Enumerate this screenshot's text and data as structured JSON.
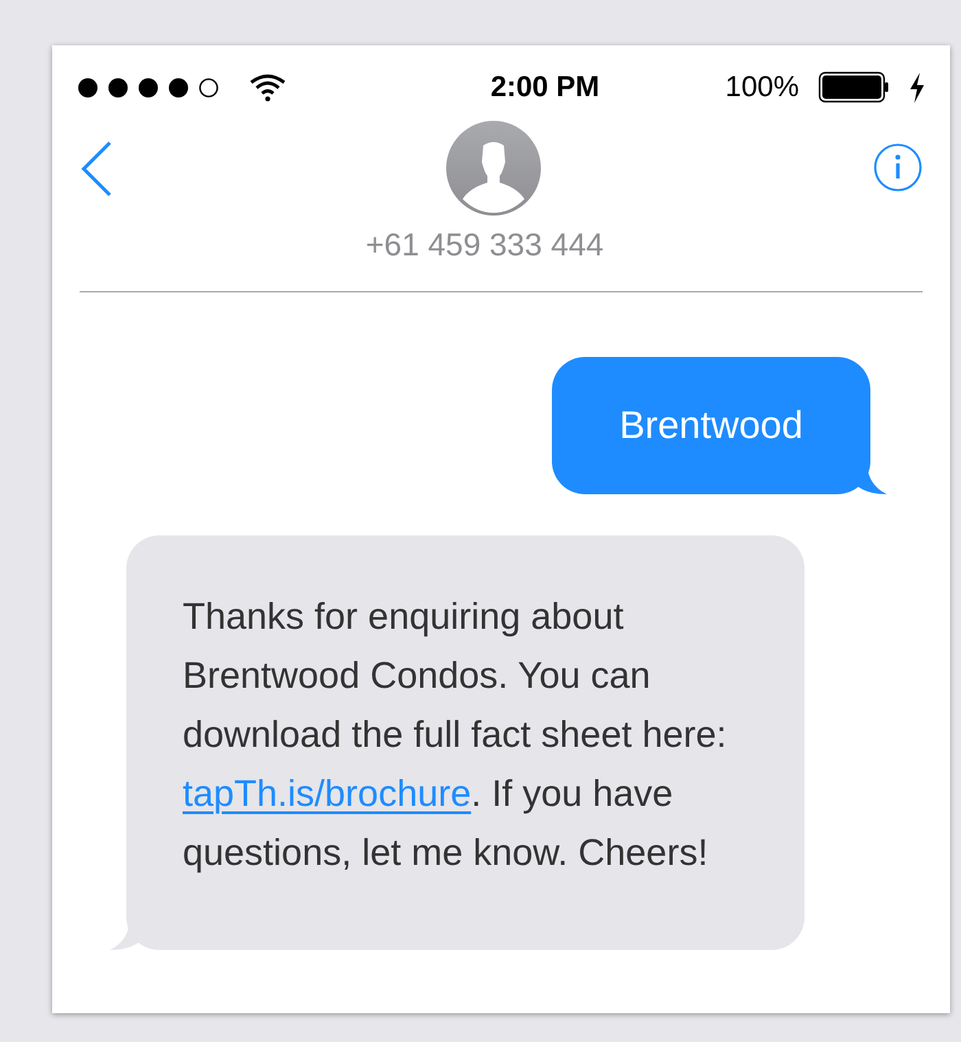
{
  "status_bar": {
    "time": "2:00 PM",
    "battery": "100%"
  },
  "contact": {
    "phone": "+61 459 333 444"
  },
  "messages": [
    {
      "kind": "sent",
      "segments": [
        {
          "kind": "text",
          "text": "Brentwood"
        }
      ]
    },
    {
      "kind": "received",
      "segments": [
        {
          "kind": "text",
          "text": "Thanks for enquiring about Brentwood Condos. You can download the full fact sheet here: "
        },
        {
          "kind": "link",
          "text": "tapTh.is/brochure"
        },
        {
          "kind": "text",
          "text": ". If you have questions, let me know. Cheers!"
        }
      ]
    }
  ]
}
